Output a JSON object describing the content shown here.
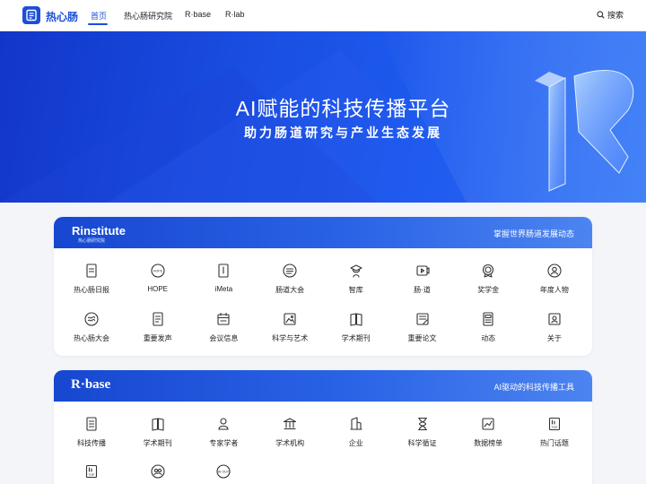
{
  "nav": {
    "brand": "热心肠",
    "items": [
      "首页",
      "热心肠研究院",
      "R·base",
      "R·lab"
    ],
    "search_label": "搜索"
  },
  "hero": {
    "title": "AI赋能的科技传播平台",
    "subtitle": "助力肠道研究与产业生态发展"
  },
  "institute": {
    "brand": "Rinstitute",
    "brand_small": "热心肠研究院",
    "tagline": "掌握世界肠道发展动态",
    "items": [
      {
        "label": "热心肠日报",
        "icon": "document-icon"
      },
      {
        "label": "HOPE",
        "icon": "hope-badge-icon"
      },
      {
        "label": "iMeta",
        "icon": "book-icon"
      },
      {
        "label": "肠道大会",
        "icon": "conference-icon"
      },
      {
        "label": "智库",
        "icon": "graduate-icon"
      },
      {
        "label": "肠·道",
        "icon": "video-icon"
      },
      {
        "label": "奖学金",
        "icon": "medal-icon"
      },
      {
        "label": "年度人物",
        "icon": "person-icon"
      },
      {
        "label": "热心肠大会",
        "icon": "meeting-icon"
      },
      {
        "label": "重要发声",
        "icon": "announcement-icon"
      },
      {
        "label": "会议信息",
        "icon": "calendar-icon"
      },
      {
        "label": "科学与艺术",
        "icon": "art-icon"
      },
      {
        "label": "学术期刊",
        "icon": "journal-icon"
      },
      {
        "label": "重要论文",
        "icon": "paper-icon"
      },
      {
        "label": "动态",
        "icon": "news-icon"
      },
      {
        "label": "关于",
        "icon": "about-icon"
      }
    ]
  },
  "rbase": {
    "brand": "R·base",
    "tagline": "AI驱动的科技传播工具",
    "items": [
      {
        "label": "科技传播",
        "icon": "broadcast-doc-icon"
      },
      {
        "label": "学术期刊",
        "icon": "journal-icon"
      },
      {
        "label": "专家学者",
        "icon": "expert-icon"
      },
      {
        "label": "学术机构",
        "icon": "institution-icon"
      },
      {
        "label": "企业",
        "icon": "building-icon"
      },
      {
        "label": "科学循证",
        "icon": "hourglass-icon"
      },
      {
        "label": "数据榜单",
        "icon": "chart-icon"
      },
      {
        "label": "热门话题",
        "icon": "top-icon"
      },
      {
        "label": "",
        "icon": "top-list-icon"
      },
      {
        "label": "",
        "icon": "team-icon"
      },
      {
        "label": "",
        "icon": "ai-out-icon"
      }
    ]
  },
  "colors": {
    "accent": "#1a4fd6",
    "hero": "#1a4fe3"
  }
}
